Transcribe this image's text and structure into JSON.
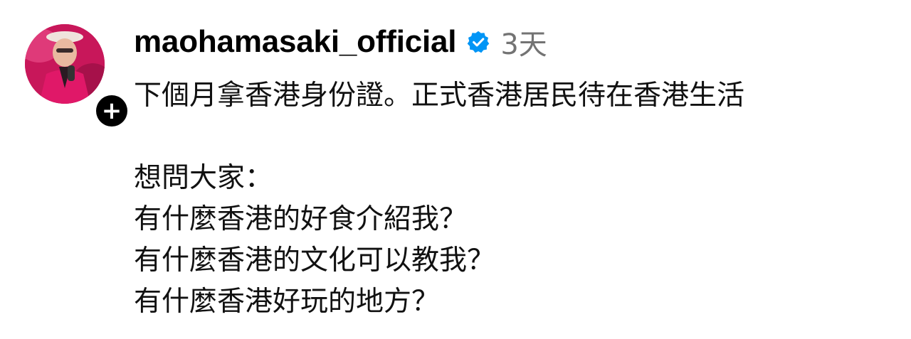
{
  "post": {
    "username": "maohamasaki_official",
    "verified": true,
    "timestamp": "3天",
    "caption_lines": [
      "下個月拿香港身份證。正式香港居民待在香港生活",
      "",
      "想問大家：",
      "有什麼香港的好食介紹我？",
      "有什麼香港的文化可以教我？",
      "有什麼香港好玩的地方？"
    ]
  },
  "icons": {
    "verified_badge": "verified-check-icon",
    "add": "plus-icon"
  },
  "colors": {
    "verified_blue": "#0095f6",
    "timestamp_gray": "#737373",
    "avatar_pink": "#d4145a"
  }
}
